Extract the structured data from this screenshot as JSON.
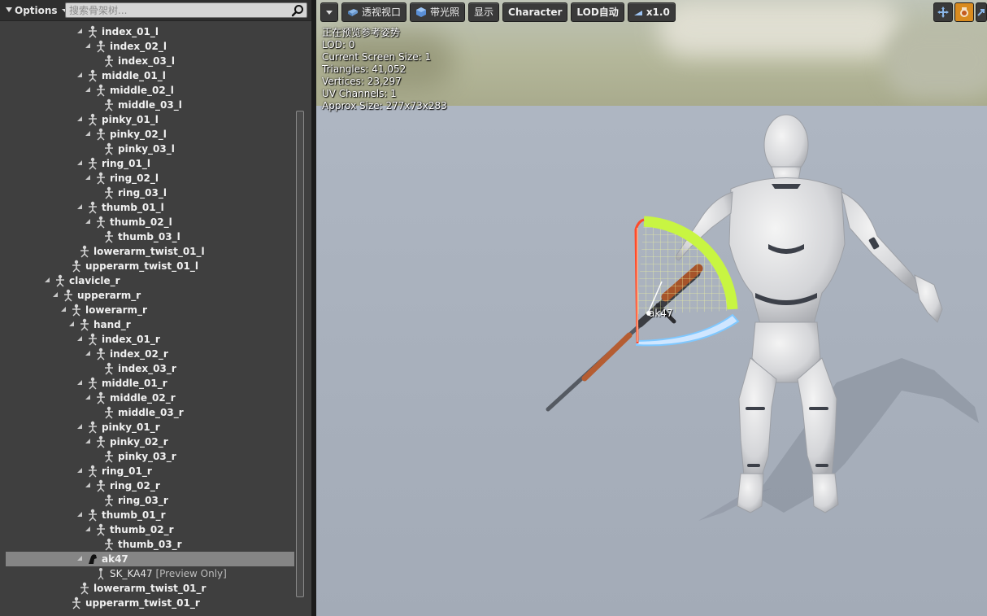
{
  "left_panel": {
    "options_label": "Options",
    "search_placeholder": "搜索骨架树..."
  },
  "tree": [
    {
      "label": "index_01_l",
      "depth": 5,
      "expander": true
    },
    {
      "label": "index_02_l",
      "depth": 6,
      "expander": true
    },
    {
      "label": "index_03_l",
      "depth": 7,
      "expander": false
    },
    {
      "label": "middle_01_l",
      "depth": 5,
      "expander": true
    },
    {
      "label": "middle_02_l",
      "depth": 6,
      "expander": true
    },
    {
      "label": "middle_03_l",
      "depth": 7,
      "expander": false
    },
    {
      "label": "pinky_01_l",
      "depth": 5,
      "expander": true
    },
    {
      "label": "pinky_02_l",
      "depth": 6,
      "expander": true
    },
    {
      "label": "pinky_03_l",
      "depth": 7,
      "expander": false
    },
    {
      "label": "ring_01_l",
      "depth": 5,
      "expander": true
    },
    {
      "label": "ring_02_l",
      "depth": 6,
      "expander": true
    },
    {
      "label": "ring_03_l",
      "depth": 7,
      "expander": false
    },
    {
      "label": "thumb_01_l",
      "depth": 5,
      "expander": true
    },
    {
      "label": "thumb_02_l",
      "depth": 6,
      "expander": true
    },
    {
      "label": "thumb_03_l",
      "depth": 7,
      "expander": false
    },
    {
      "label": "lowerarm_twist_01_l",
      "depth": 4,
      "expander": false
    },
    {
      "label": "upperarm_twist_01_l",
      "depth": 3,
      "expander": false
    },
    {
      "label": "clavicle_r",
      "depth": 1,
      "expander": true
    },
    {
      "label": "upperarm_r",
      "depth": 2,
      "expander": true
    },
    {
      "label": "lowerarm_r",
      "depth": 3,
      "expander": true
    },
    {
      "label": "hand_r",
      "depth": 4,
      "expander": true
    },
    {
      "label": "index_01_r",
      "depth": 5,
      "expander": true
    },
    {
      "label": "index_02_r",
      "depth": 6,
      "expander": true
    },
    {
      "label": "index_03_r",
      "depth": 7,
      "expander": false
    },
    {
      "label": "middle_01_r",
      "depth": 5,
      "expander": true
    },
    {
      "label": "middle_02_r",
      "depth": 6,
      "expander": true
    },
    {
      "label": "middle_03_r",
      "depth": 7,
      "expander": false
    },
    {
      "label": "pinky_01_r",
      "depth": 5,
      "expander": true
    },
    {
      "label": "pinky_02_r",
      "depth": 6,
      "expander": true
    },
    {
      "label": "pinky_03_r",
      "depth": 7,
      "expander": false
    },
    {
      "label": "ring_01_r",
      "depth": 5,
      "expander": true
    },
    {
      "label": "ring_02_r",
      "depth": 6,
      "expander": true
    },
    {
      "label": "ring_03_r",
      "depth": 7,
      "expander": false
    },
    {
      "label": "thumb_01_r",
      "depth": 5,
      "expander": true
    },
    {
      "label": "thumb_02_r",
      "depth": 6,
      "expander": true
    },
    {
      "label": "thumb_03_r",
      "depth": 7,
      "expander": false
    },
    {
      "label": "ak47",
      "depth": 5,
      "expander": true,
      "type": "socket",
      "selected": true
    },
    {
      "label": "SK_KA47",
      "depth": 6,
      "expander": false,
      "type": "mesh",
      "tag": "[Preview Only]"
    },
    {
      "label": "lowerarm_twist_01_r",
      "depth": 4,
      "expander": false
    },
    {
      "label": "upperarm_twist_01_r",
      "depth": 3,
      "expander": false
    }
  ],
  "viewport": {
    "toolbar": {
      "perspective": "透视视口",
      "lit": "带光照",
      "show": "显示",
      "character": "Character",
      "lod": "LOD自动",
      "speed": "x1.0"
    },
    "stats": {
      "line1": "正在预览参考姿势",
      "line2": "LOD: 0",
      "line3": "Current Screen Size: 1",
      "line4": "Triangles: 41,052",
      "line5": "Vertices: 23,297",
      "line6": "UV Channels: 1",
      "line7": "Approx Size: 277x73x283"
    },
    "socket_label": "ak47",
    "right_tool_icons": [
      "transform-icon",
      "camera-icon",
      "more-icon"
    ]
  },
  "colors": {
    "panel_bg": "#3f3f3f",
    "selected_row": "#858585",
    "active_tool": "#d98b1f",
    "gizmo_green": "#c8f542",
    "gizmo_red": "#ff4a2a",
    "gizmo_blue": "#7fc8ff"
  }
}
